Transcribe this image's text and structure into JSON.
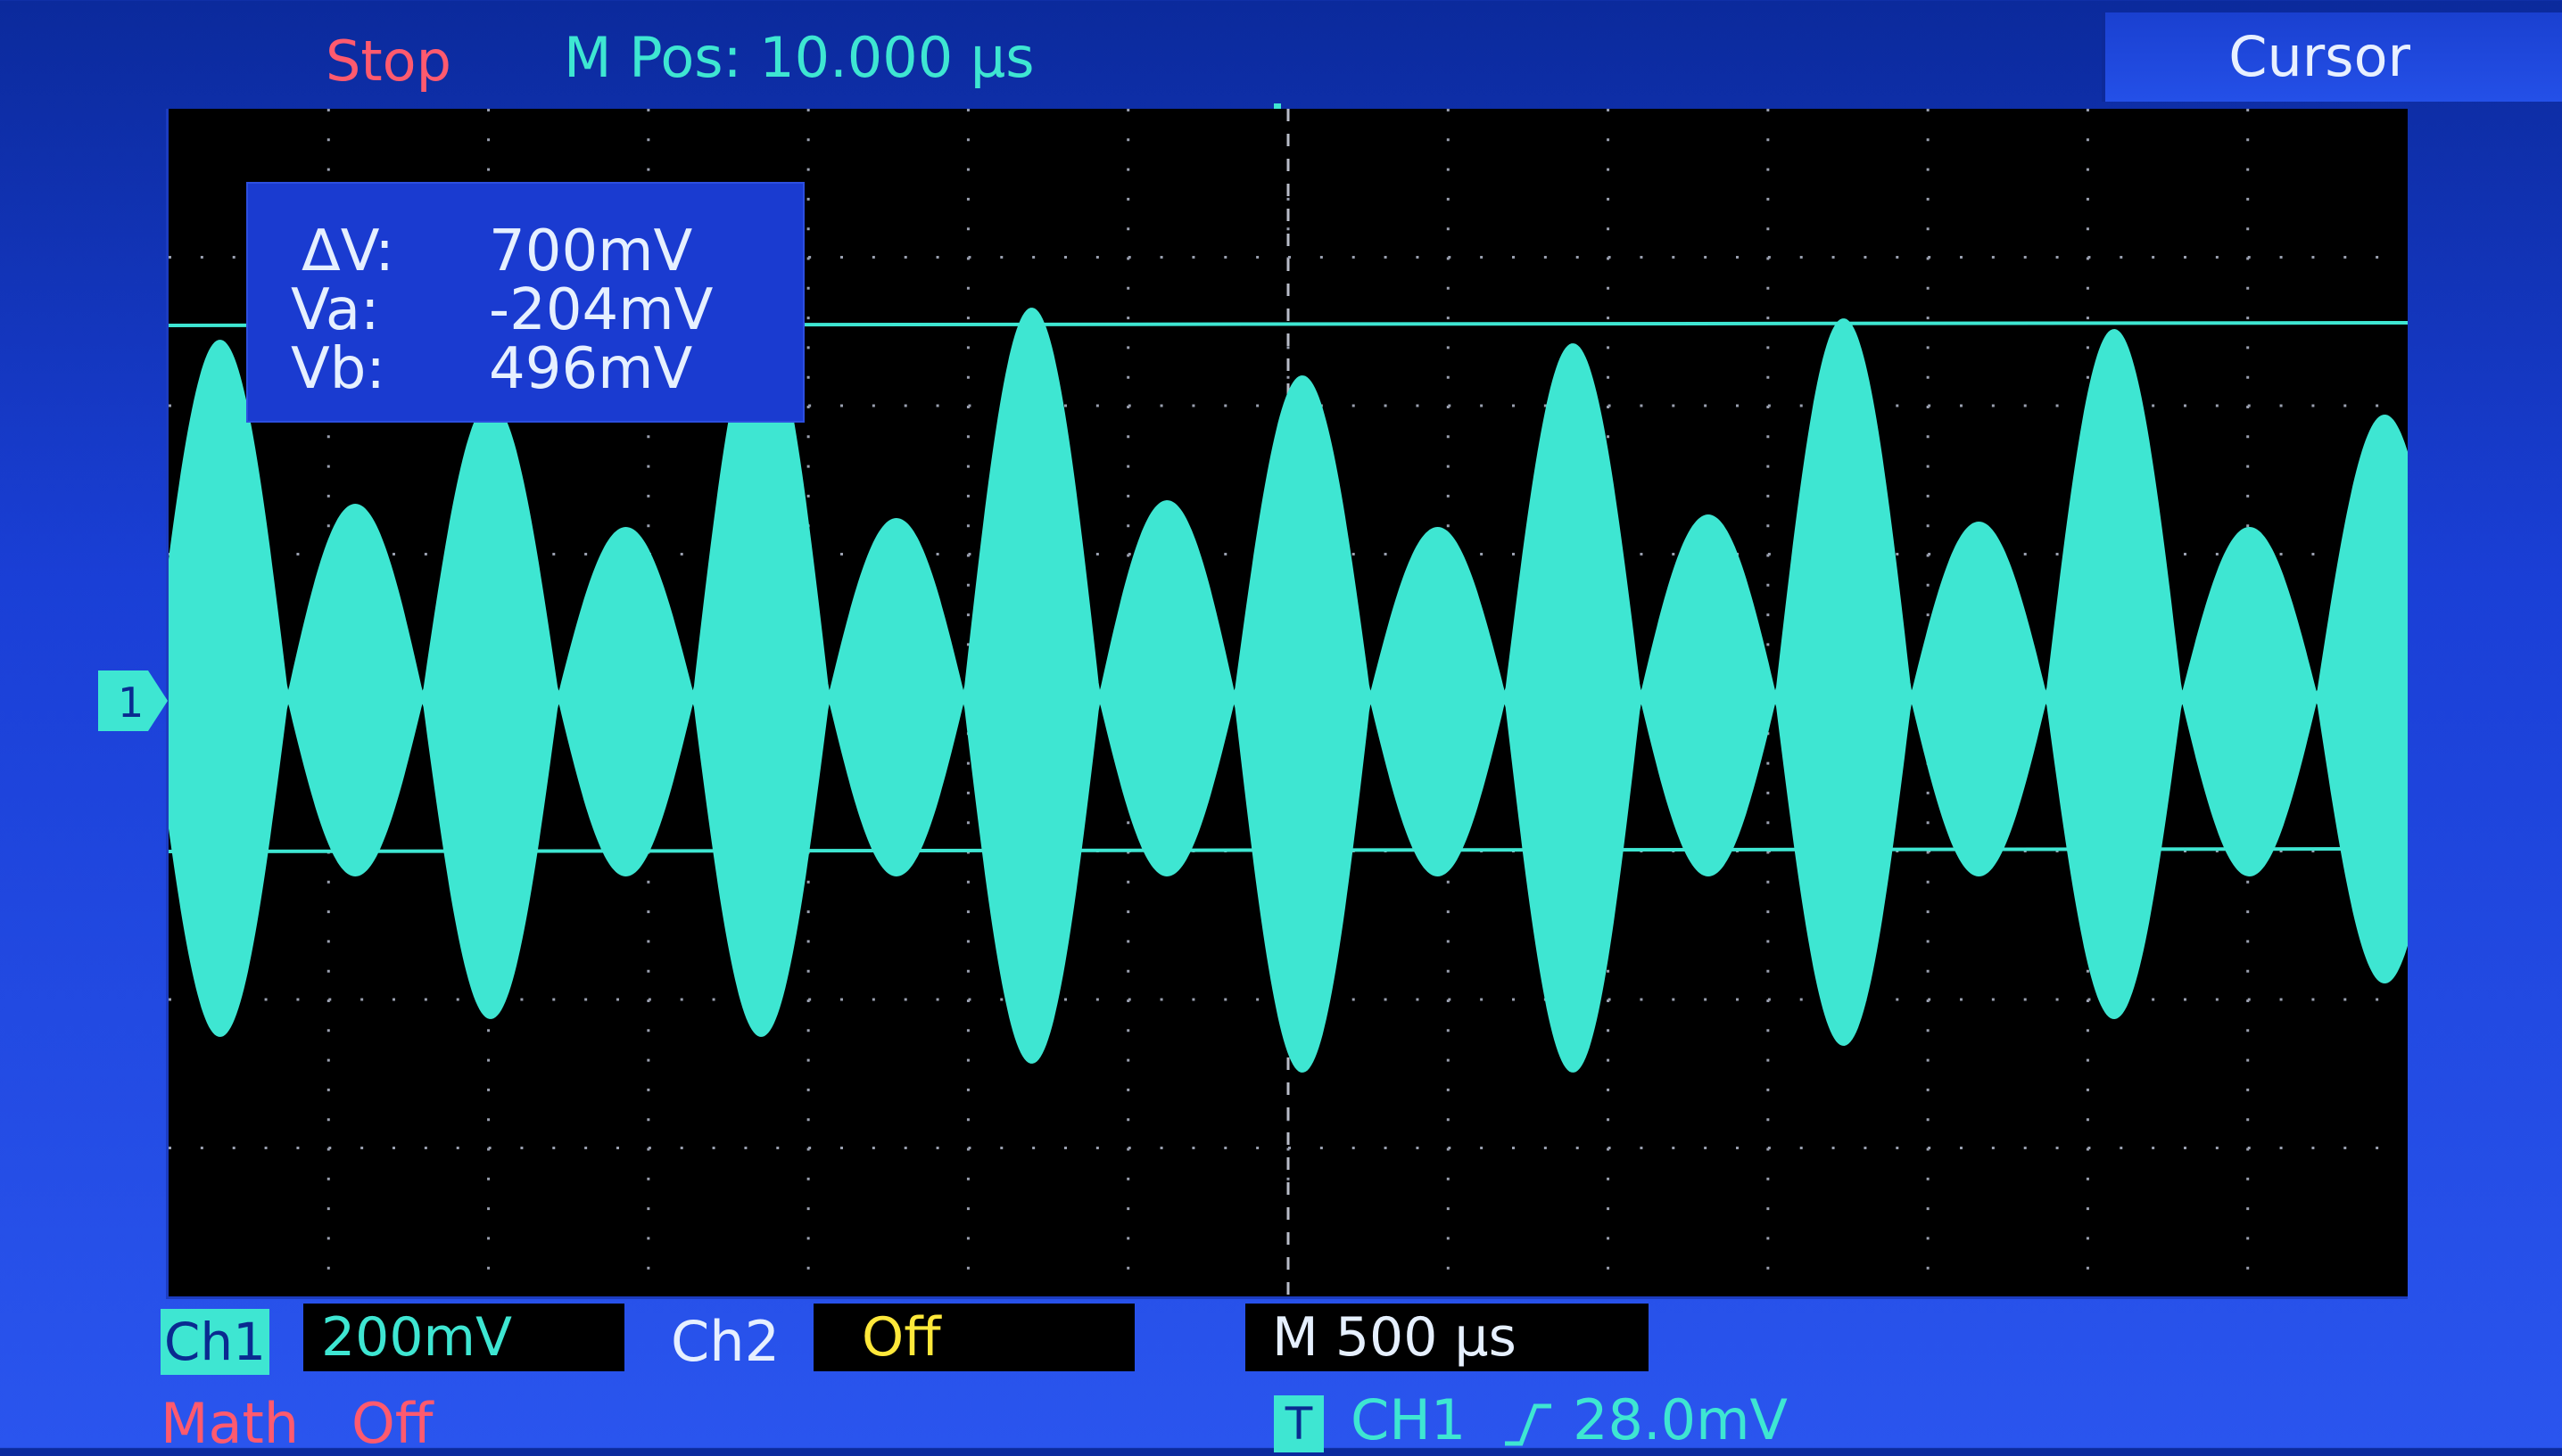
{
  "header": {
    "status": "Stop",
    "m_pos": "M Pos: 10.000 µs",
    "menu": "Cursor"
  },
  "readout": {
    "rows": [
      {
        "label": "ΔV:",
        "value": "700mV"
      },
      {
        "label": "Va:",
        "value": "-204mV"
      },
      {
        "label": "Vb:",
        "value": "496mV"
      }
    ]
  },
  "channel_marker": "1",
  "footer": {
    "ch1_label": "Ch1",
    "ch1_scale": "200mV",
    "ch2_label": "Ch2",
    "ch2_scale": "Off",
    "timebase": "M 500 µs",
    "math_label": "Math",
    "math_state": "Off",
    "trigger_icon": "T",
    "trigger_source": "CH1",
    "trigger_edge_icon": "rising-edge-icon",
    "trigger_level": "28.0mV"
  },
  "colors": {
    "trace": "#3ee6d2",
    "stop": "#ff5a6e",
    "ch2": "#ffe83a",
    "background": "#1a3fd6"
  },
  "waveform": {
    "lobes": [
      200,
      108,
      165,
      95,
      210,
      100,
      218,
      110,
      180,
      95,
      198,
      102,
      212,
      98,
      206,
      95,
      158
    ],
    "lobe_mins": [
      190,
      100,
      180,
      100,
      190,
      100,
      205,
      100,
      210,
      100,
      210,
      100,
      195,
      100,
      180,
      100,
      160
    ]
  }
}
